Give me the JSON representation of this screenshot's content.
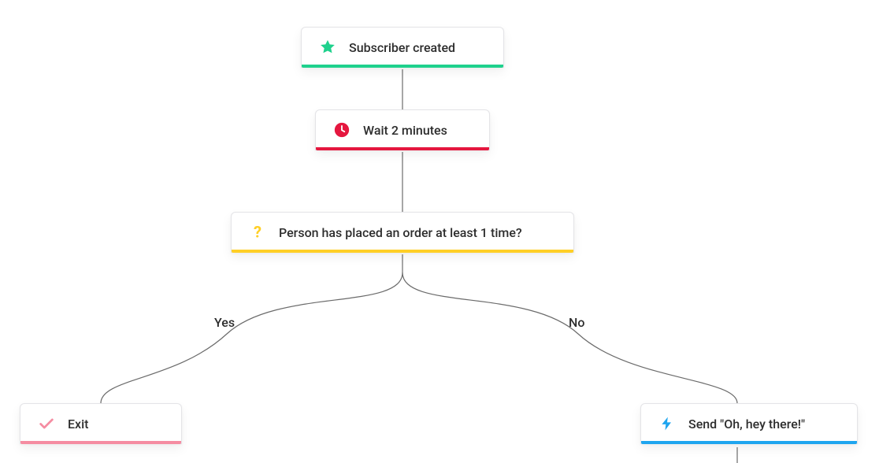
{
  "colors": {
    "green": "#1fd18d",
    "red": "#e5173f",
    "yellow": "#ffcf26",
    "pink": "#f58ca1",
    "blue": "#1ea5ef",
    "connector": "#6b6b6b"
  },
  "nodes": {
    "trigger": {
      "label": "Subscriber created",
      "accent": "green",
      "icon": "star"
    },
    "wait": {
      "label": "Wait 2 minutes",
      "accent": "red",
      "icon": "clock"
    },
    "condition": {
      "label": "Person has placed an order at least 1 time?",
      "accent": "yellow",
      "icon": "question"
    },
    "exit": {
      "label": "Exit",
      "accent": "pink",
      "icon": "check"
    },
    "send": {
      "label": "Send \"Oh, hey there!\"",
      "accent": "blue",
      "icon": "bolt"
    }
  },
  "branches": {
    "yes": "Yes",
    "no": "No"
  }
}
